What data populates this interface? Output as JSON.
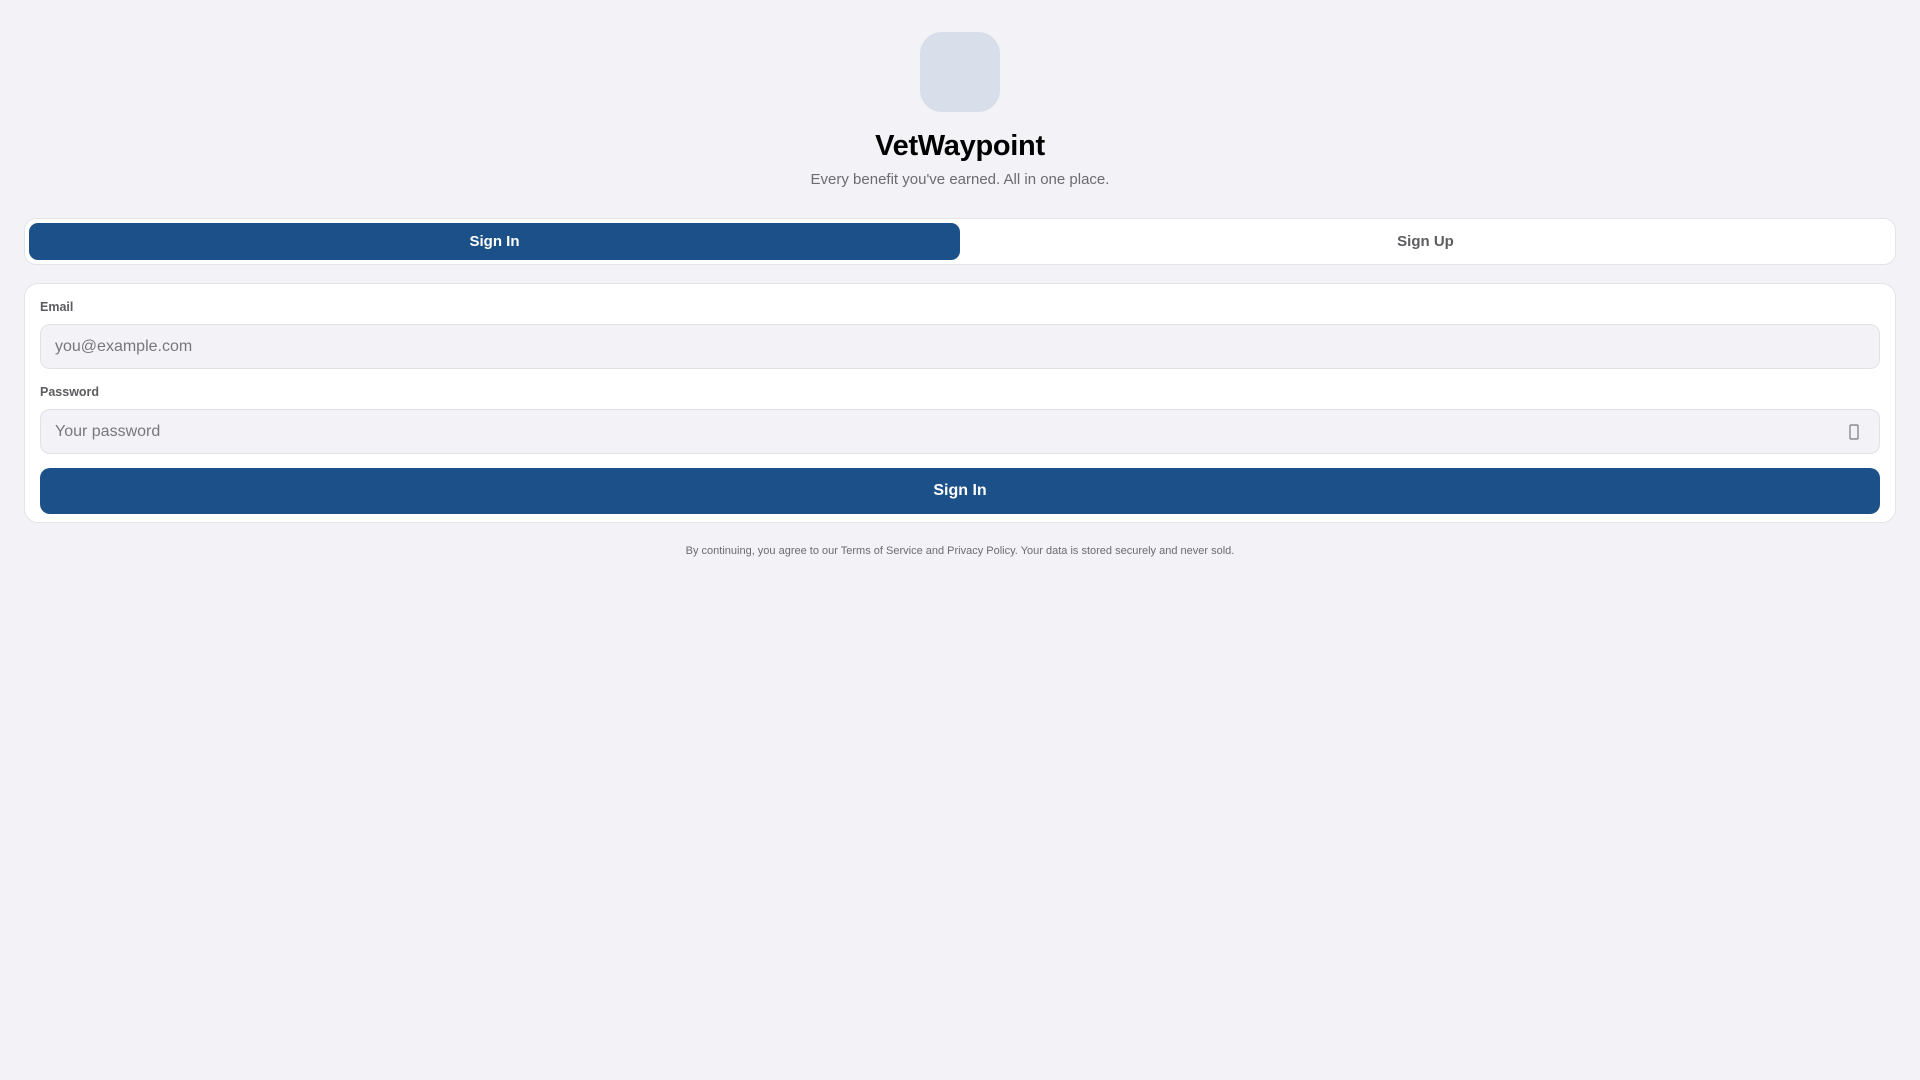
{
  "app": {
    "title": "VetWaypoint",
    "tagline": "Every benefit you've earned. All in one place."
  },
  "tabs": [
    {
      "label": "Sign In",
      "active": true
    },
    {
      "label": "Sign Up",
      "active": false
    }
  ],
  "form": {
    "email": {
      "label": "Email",
      "placeholder": "you@example.com",
      "value": ""
    },
    "password": {
      "label": "Password",
      "placeholder": "Your password",
      "value": "",
      "toggle_icon": "eye-icon"
    },
    "submit_label": "Sign In"
  },
  "footer": {
    "note": "By continuing, you agree to our Terms of Service and Privacy Policy. Your data is stored securely and never sold."
  },
  "colors": {
    "accent": "#1b5088",
    "background": "#f2f2f7",
    "logo_placeholder": "#d8deea"
  }
}
